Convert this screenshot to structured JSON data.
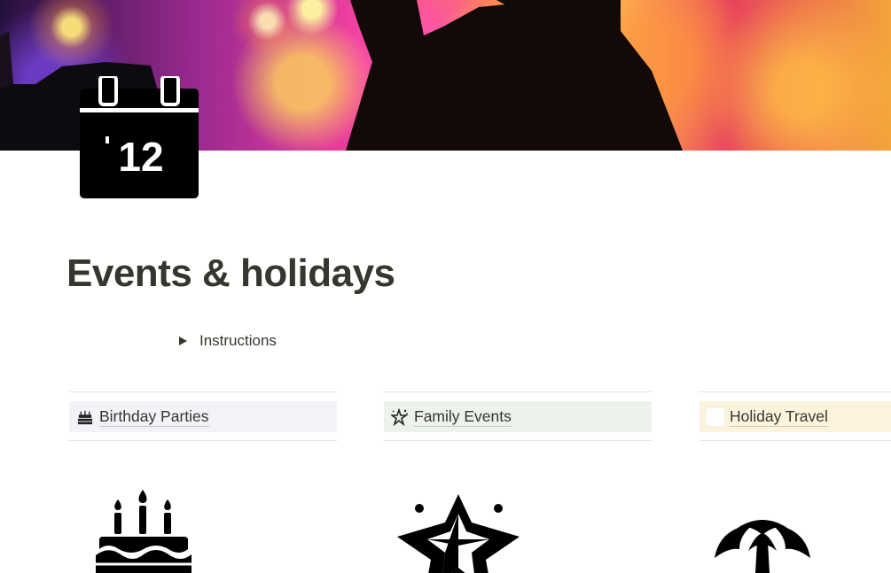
{
  "page": {
    "title": "Events & holidays",
    "icon": "calendar-12-icon",
    "icon_text": "12",
    "cover": "concert-crowd-lights-cover"
  },
  "toggle": {
    "label": "Instructions"
  },
  "columns": [
    {
      "label": "Birthday Parties",
      "emoji": "birthday-cake-icon",
      "header_color": "#f4f2f7",
      "big_icon": "birthday-cake-icon"
    },
    {
      "label": "Family Events",
      "emoji": "sparkle-star-icon",
      "header_color": "#edf3ec",
      "big_icon": "star-icon"
    },
    {
      "label": "Holiday Travel",
      "emoji": "blank-icon",
      "header_color": "#fbf3db",
      "big_icon": "palm-tree-icon"
    }
  ]
}
